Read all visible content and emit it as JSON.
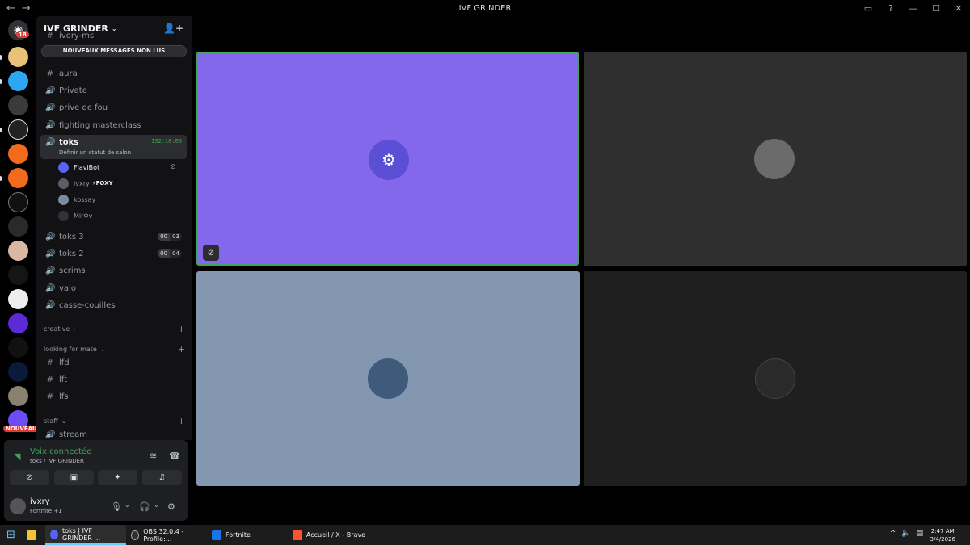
{
  "window": {
    "title": "IVF GRINDER",
    "back_icon": "←",
    "forward_icon": "→"
  },
  "rail": {
    "notification_count": "18",
    "new_badge": "NOUVEAU"
  },
  "guild": {
    "name": "IVF GRINDER",
    "unread_banner": "NOUVEAUX MESSAGES NON LUS",
    "channels_top": [
      {
        "name": "ivory-ms",
        "icon": "#"
      },
      {
        "name": "aura",
        "icon": "#"
      },
      {
        "name": "Private",
        "icon": "🔊"
      },
      {
        "name": "prive de fou",
        "icon": "🔊"
      },
      {
        "name": "fighting masterclass",
        "icon": "🔊"
      }
    ],
    "active_channel": {
      "name": "toks",
      "timer": "132:18:00",
      "status_prompt": "Définir un statut de salon"
    },
    "voice_users": [
      {
        "name": "FlaviBot",
        "tag": ""
      },
      {
        "name": "ivxry",
        "tag": "⚡FOXY"
      },
      {
        "name": "kossay",
        "tag": ""
      },
      {
        "name": "MirΦv",
        "tag": ""
      }
    ],
    "channels_mid": [
      {
        "name": "toks 3",
        "count_a": "00",
        "count_b": "03"
      },
      {
        "name": "toks 2",
        "count_a": "00",
        "count_b": "04"
      },
      {
        "name": "scrims"
      },
      {
        "name": "valo"
      },
      {
        "name": "casse-couilles"
      }
    ],
    "category_creative": "creative",
    "category_looking": "looking for mate",
    "looking_channels": [
      "lfd",
      "lft",
      "lfs"
    ],
    "category_staff": "staff",
    "staff_channels": [
      "stream"
    ]
  },
  "voice_panel": {
    "status": "Voix connectée",
    "location": "toks / IVF GRINDER"
  },
  "me": {
    "name": "ivxry",
    "activity": "Fortnite +1"
  },
  "taskbar": {
    "apps": [
      {
        "label": "toks | IVF GRINDER ...",
        "color": "#5865f2"
      },
      {
        "label": "OBS 32.0.4 - Profile:...",
        "color": "#302e31"
      },
      {
        "label": "Fortnite",
        "color": "#1a73e8"
      },
      {
        "label": "Accueil / X - Brave",
        "color": "#fb542b"
      }
    ],
    "time": "2:47 AM",
    "date": "3/4/2026"
  },
  "colors": {
    "accent_green": "#43a25a",
    "tile_bot": "#8468ec",
    "tile_grey": "#2f2f2f",
    "tile_blue": "#8497b0",
    "tile_dark": "#1f1f1f"
  }
}
